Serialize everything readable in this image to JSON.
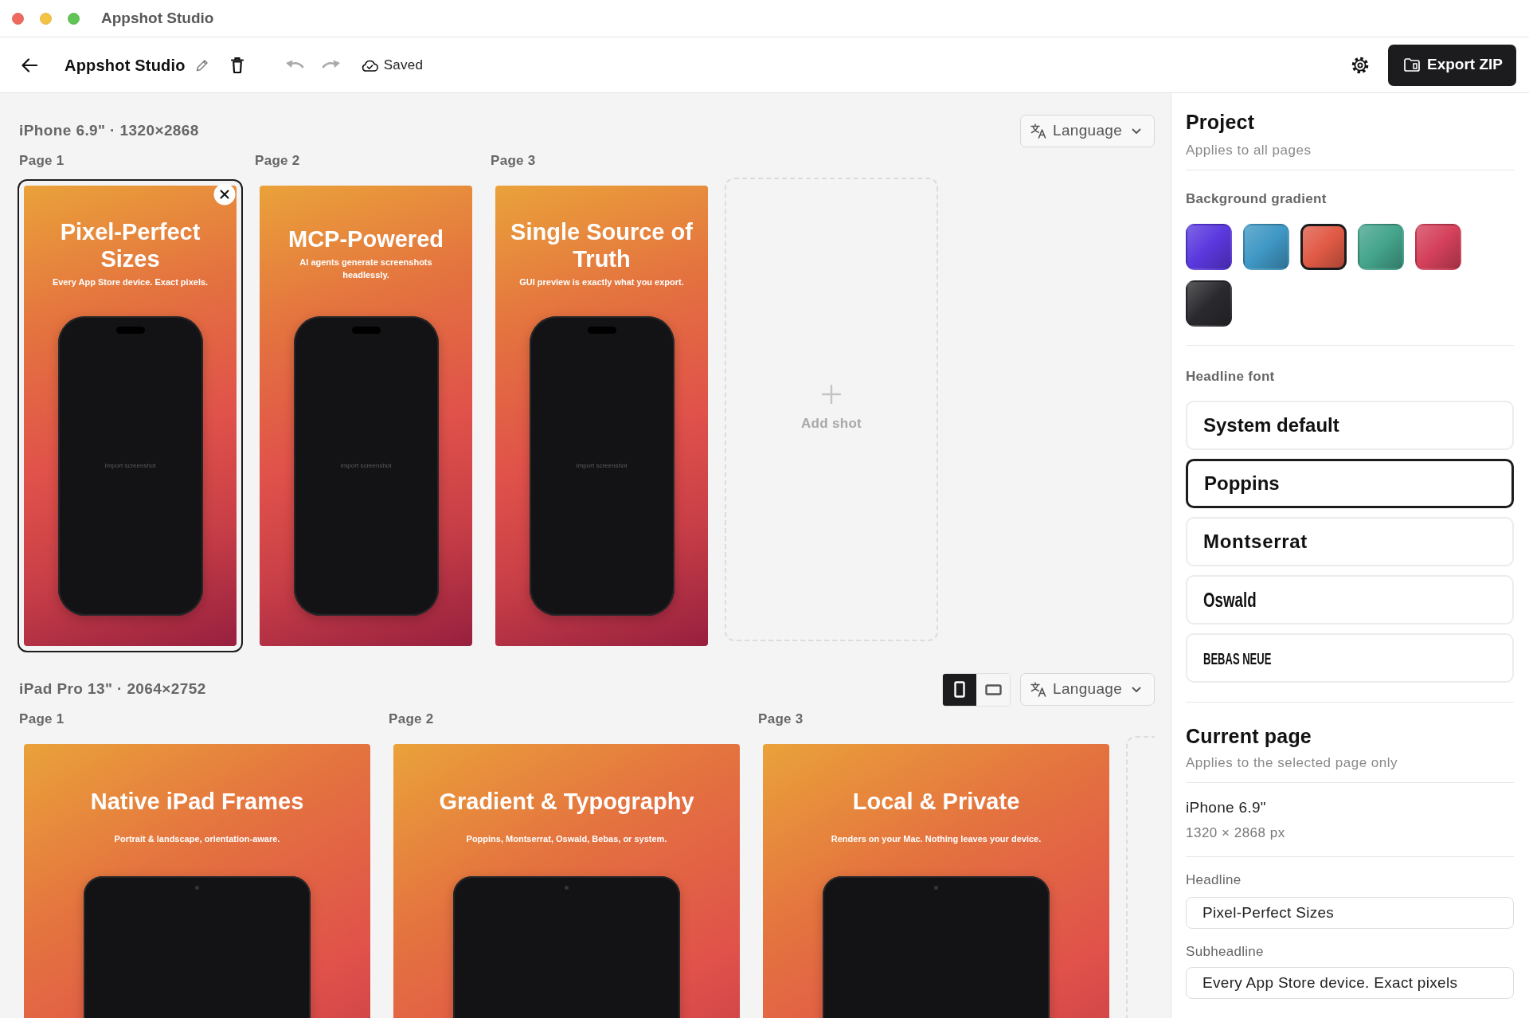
{
  "window": {
    "title": "Appshot Studio"
  },
  "toolbar": {
    "project_name": "Appshot Studio",
    "undo": {
      "disabled": true
    },
    "redo": {
      "disabled": true
    },
    "save_status": "Saved",
    "export_button": "Export ZIP"
  },
  "devices": [
    {
      "kind": "phone",
      "title": "iPhone 6.9\" · 1320×2868",
      "language_button": "Language",
      "pages": [
        {
          "label": "Page 1",
          "headline": "Pixel-Perfect Sizes",
          "subheadline": "Every App Store device. Exact pixels.",
          "screen_hint": "Import screenshot",
          "selected": true
        },
        {
          "label": "Page 2",
          "headline": "MCP-Powered",
          "subheadline": "AI agents generate screenshots headlessly.",
          "screen_hint": "Import screenshot",
          "selected": false
        },
        {
          "label": "Page 3",
          "headline": "Single Source of Truth",
          "subheadline": "GUI preview is exactly what you export.",
          "screen_hint": "Import screenshot",
          "selected": false
        }
      ],
      "add_shot": "Add shot"
    },
    {
      "kind": "tablet",
      "title": "iPad Pro 13\" · 2064×2752",
      "orientations": [
        {
          "kind": "portrait",
          "selected": true
        },
        {
          "kind": "landscape",
          "selected": false
        }
      ],
      "language_button": "Language",
      "pages": [
        {
          "label": "Page 1",
          "headline": "Native iPad Frames",
          "subheadline": "Portrait & landscape, orientation-aware.",
          "selected": false
        },
        {
          "label": "Page 2",
          "headline": "Gradient & Typography",
          "subheadline": "Poppins, Montserrat, Oswald, Bebas, or system.",
          "selected": false
        },
        {
          "label": "Page 3",
          "headline": "Local & Private",
          "subheadline": "Renders on your Mac. Nothing leaves your device.",
          "selected": false
        }
      ]
    }
  ],
  "inspector": {
    "project": {
      "title": "Project",
      "subtitle": "Applies to all pages",
      "gradient_label": "Background gradient",
      "gradients": [
        {
          "color": "#5a38de",
          "selected": false
        },
        {
          "color": "#3f97c4",
          "selected": false
        },
        {
          "color": "#e05a45",
          "selected": true
        },
        {
          "color": "#44a48c",
          "selected": false
        },
        {
          "color": "#d4405a",
          "selected": false
        },
        {
          "color": "#2a2a2e",
          "selected": false
        }
      ],
      "font_label": "Headline font",
      "fonts": [
        {
          "label": "System default",
          "selected": false
        },
        {
          "label": "Poppins",
          "selected": true
        },
        {
          "label": "Montserrat",
          "selected": false
        },
        {
          "label": "Oswald",
          "selected": false
        },
        {
          "label": "BEBAS NEUE",
          "selected": false
        }
      ]
    },
    "current_page": {
      "title": "Current page",
      "subtitle": "Applies to the selected page only",
      "device": "iPhone 6.9\"",
      "size": "1320 × 2868 px",
      "fields": [
        {
          "label": "Headline",
          "value": "Pixel-Perfect Sizes"
        },
        {
          "label": "Subheadline",
          "value": "Every App Store device. Exact pixels"
        }
      ]
    }
  }
}
